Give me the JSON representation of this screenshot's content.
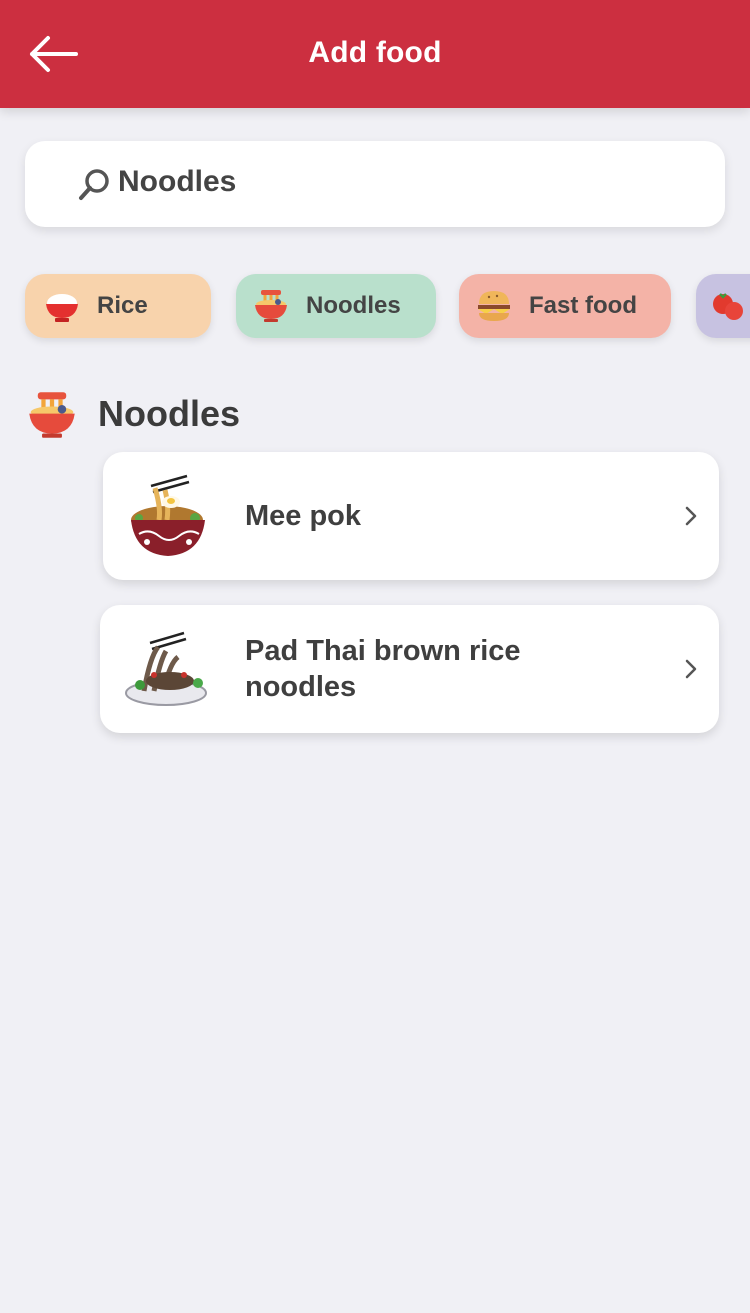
{
  "header": {
    "title": "Add food",
    "back_icon": "arrow-left-icon"
  },
  "search": {
    "value": "Noodles",
    "icon": "search-icon"
  },
  "categories": [
    {
      "label": "Rice",
      "icon": "rice-bowl-icon",
      "color": "#f8d3ac"
    },
    {
      "label": "Noodles",
      "icon": "noodle-bowl-icon",
      "color": "#b9e0cc"
    },
    {
      "label": "Fast food",
      "icon": "burger-icon",
      "color": "#f4b3a7"
    },
    {
      "label": "",
      "icon": "tomato-icon",
      "color": "#c7c2e1"
    }
  ],
  "section": {
    "title": "Noodles",
    "icon": "noodle-bowl-icon"
  },
  "results": [
    {
      "name": "Mee pok",
      "image": "mee-pok-dish-image"
    },
    {
      "name": "Pad Thai brown rice noodles",
      "image": "pad-thai-dish-image"
    }
  ],
  "colors": {
    "header": "#cc2f40",
    "background": "#f0f0f5"
  }
}
